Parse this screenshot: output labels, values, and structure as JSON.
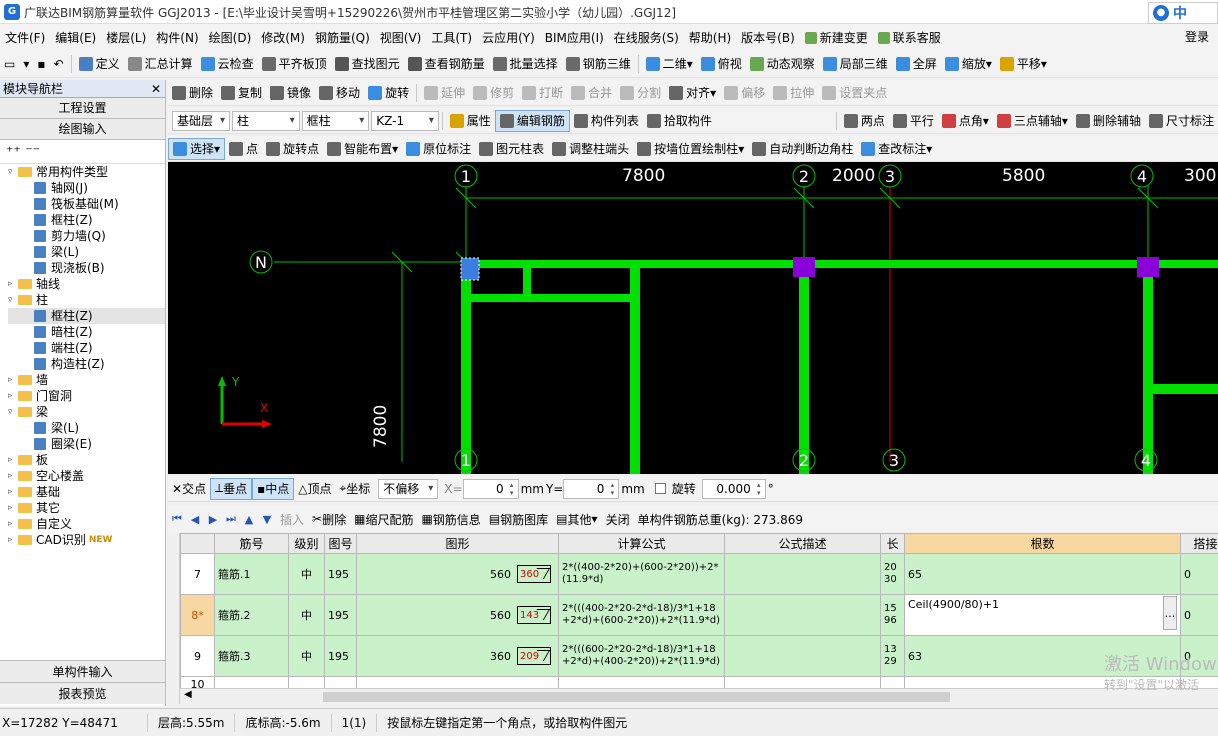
{
  "app": {
    "title": "广联达BIM钢筋算量软件 GGJ2013 - [E:\\毕业设计吴雪明+15290226\\贺州市平桂管理区第二实验小学（幼儿园）.GGJ12]",
    "ime_label": "中",
    "accent_color": "#1f6fd6"
  },
  "menu": {
    "items": [
      "文件(F)",
      "编辑(E)",
      "楼层(L)",
      "构件(N)",
      "绘图(D)",
      "修改(M)",
      "钢筋量(Q)",
      "视图(V)",
      "工具(T)",
      "云应用(Y)",
      "BIM应用(I)",
      "在线服务(S)",
      "帮助(H)",
      "版本号(B)"
    ],
    "new_change": "新建变更",
    "support": "联系客服",
    "login": "登录"
  },
  "toolbar1": {
    "items": [
      "定义",
      "汇总计算",
      "云检查",
      "平齐板顶",
      "查找图元",
      "查看钢筋量",
      "批量选择",
      "钢筋三维"
    ],
    "view_mode": "二维",
    "items2": [
      "俯视",
      "动态观察",
      "局部三维",
      "全屏",
      "缩放",
      "平移"
    ]
  },
  "toolbar2": {
    "items": [
      "删除",
      "复制",
      "镜像",
      "移动",
      "旋转",
      "延伸",
      "修剪",
      "打断",
      "合并",
      "分割",
      "对齐",
      "偏移",
      "拉伸",
      "设置夹点"
    ]
  },
  "toolbar3": {
    "floor": "基础层",
    "category": "柱",
    "type": "框柱",
    "component": "KZ-1",
    "items": [
      "属性",
      "编辑钢筋",
      "构件列表",
      "拾取构件"
    ],
    "axis_items": [
      "两点",
      "平行",
      "点角",
      "三点辅轴",
      "删除辅轴",
      "尺寸标注"
    ]
  },
  "toolbar4": {
    "items": [
      "选择",
      "点",
      "旋转点",
      "智能布置",
      "原位标注",
      "图元柱表",
      "调整柱端头",
      "按墙位置绘制柱",
      "自动判断边角柱",
      "查改标注"
    ]
  },
  "nav": {
    "header": "模块导航栏",
    "project_settings": "工程设置",
    "drawing_input": "绘图输入",
    "single_input": "单构件输入",
    "report_preview": "报表预览",
    "tree": [
      {
        "label": "常用构件类型",
        "type": "folder",
        "open": true,
        "level": 1
      },
      {
        "label": "轴网(J)",
        "type": "leaf",
        "level": 2
      },
      {
        "label": "筏板基础(M)",
        "type": "leaf",
        "level": 2
      },
      {
        "label": "框柱(Z)",
        "type": "leaf",
        "level": 2
      },
      {
        "label": "剪力墙(Q)",
        "type": "leaf",
        "level": 2
      },
      {
        "label": "梁(L)",
        "type": "leaf",
        "level": 2
      },
      {
        "label": "现浇板(B)",
        "type": "leaf",
        "level": 2
      },
      {
        "label": "轴线",
        "type": "folder",
        "open": false,
        "level": 1
      },
      {
        "label": "柱",
        "type": "folder",
        "open": true,
        "level": 1
      },
      {
        "label": "框柱(Z)",
        "type": "leaf",
        "level": 2,
        "selected": true
      },
      {
        "label": "暗柱(Z)",
        "type": "leaf",
        "level": 2
      },
      {
        "label": "端柱(Z)",
        "type": "leaf",
        "level": 2
      },
      {
        "label": "构造柱(Z)",
        "type": "leaf",
        "level": 2
      },
      {
        "label": "墙",
        "type": "folder",
        "open": false,
        "level": 1
      },
      {
        "label": "门窗洞",
        "type": "folder",
        "open": false,
        "level": 1
      },
      {
        "label": "梁",
        "type": "folder",
        "open": true,
        "level": 1
      },
      {
        "label": "梁(L)",
        "type": "leaf",
        "level": 2
      },
      {
        "label": "圈梁(E)",
        "type": "leaf",
        "level": 2
      },
      {
        "label": "板",
        "type": "folder",
        "open": false,
        "level": 1
      },
      {
        "label": "空心楼盖",
        "type": "folder",
        "open": false,
        "level": 1
      },
      {
        "label": "基础",
        "type": "folder",
        "open": false,
        "level": 1
      },
      {
        "label": "其它",
        "type": "folder",
        "open": false,
        "level": 1
      },
      {
        "label": "自定义",
        "type": "folder",
        "open": false,
        "level": 1
      },
      {
        "label": "CAD识别",
        "type": "folder",
        "open": false,
        "level": 1,
        "badge": "NEW"
      }
    ]
  },
  "canvas": {
    "axis_labels": [
      "1",
      "2",
      "3",
      "4",
      "N"
    ],
    "dims": [
      "7800",
      "2000",
      "5800",
      "300",
      "7800"
    ],
    "ucs_x": "X",
    "ucs_y": "Y",
    "colors": {
      "beam": "#00e000",
      "column": "#8a00d8",
      "selected_column": "#3a7fe0",
      "axis": "#00e000",
      "red_line": "#e00000"
    }
  },
  "snapbar": {
    "items": [
      "交点",
      "垂点",
      "中点",
      "顶点",
      "坐标"
    ],
    "offset_mode": "不偏移",
    "x_label": "X=",
    "x_value": "0",
    "y_label": "Y=",
    "y_value": "0",
    "unit": "mm",
    "rotate_label": "旋转",
    "rotate_value": "0.000",
    "degree": "°"
  },
  "gridbar": {
    "items": [
      "插入",
      "删除",
      "缩尺配筋",
      "钢筋信息",
      "钢筋图库",
      "其他",
      "关闭"
    ],
    "total_label": "单构件钢筋总重(kg): 273.869"
  },
  "grid": {
    "columns": [
      "",
      "筋号",
      "级别",
      "图号",
      "图形",
      "计算公式",
      "公式描述",
      "长",
      "根数",
      "搭接"
    ],
    "rows": [
      {
        "num": "7",
        "name": "箍筋.1",
        "grade": "中",
        "fig": "195",
        "dim": "560",
        "shape": "360",
        "formula": "2*((400-2*20)+(600-2*20))+2*(11.9*d)",
        "desc": "",
        "length": "2030",
        "count": "65",
        "lap": "0"
      },
      {
        "num": "8*",
        "name": "箍筋.2",
        "grade": "中",
        "fig": "195",
        "dim": "560",
        "shape": "143",
        "formula": "2*(((400-2*20-2*d-18)/3*1+18+2*d)+(600-2*20))+2*(11.9*d)",
        "desc": "",
        "length": "1596",
        "count": "Ceil(4900/80)+1",
        "lap": "0"
      },
      {
        "num": "9",
        "name": "箍筋.3",
        "grade": "中",
        "fig": "195",
        "dim": "360",
        "shape": "209",
        "formula": "2*(((600-2*20-2*d-18)/3*1+18+2*d)+(400-2*20))+2*(11.9*d)",
        "desc": "",
        "length": "1329",
        "count": "63",
        "lap": "0"
      },
      {
        "num": "10",
        "name": "",
        "grade": "",
        "fig": "",
        "dim": "",
        "shape": "",
        "formula": "",
        "desc": "",
        "length": "",
        "count": "",
        "lap": ""
      }
    ]
  },
  "status": {
    "coords": "X=17282 Y=48471",
    "floor_height": "层高:5.55m",
    "bottom_elev": "底标高:-5.6m",
    "count": "1(1)",
    "hint": "按鼠标左键指定第一个角点，或拾取构件图元"
  },
  "watermark": {
    "line1": "激活 Window",
    "line2": "转到\"设置\"以激活"
  }
}
